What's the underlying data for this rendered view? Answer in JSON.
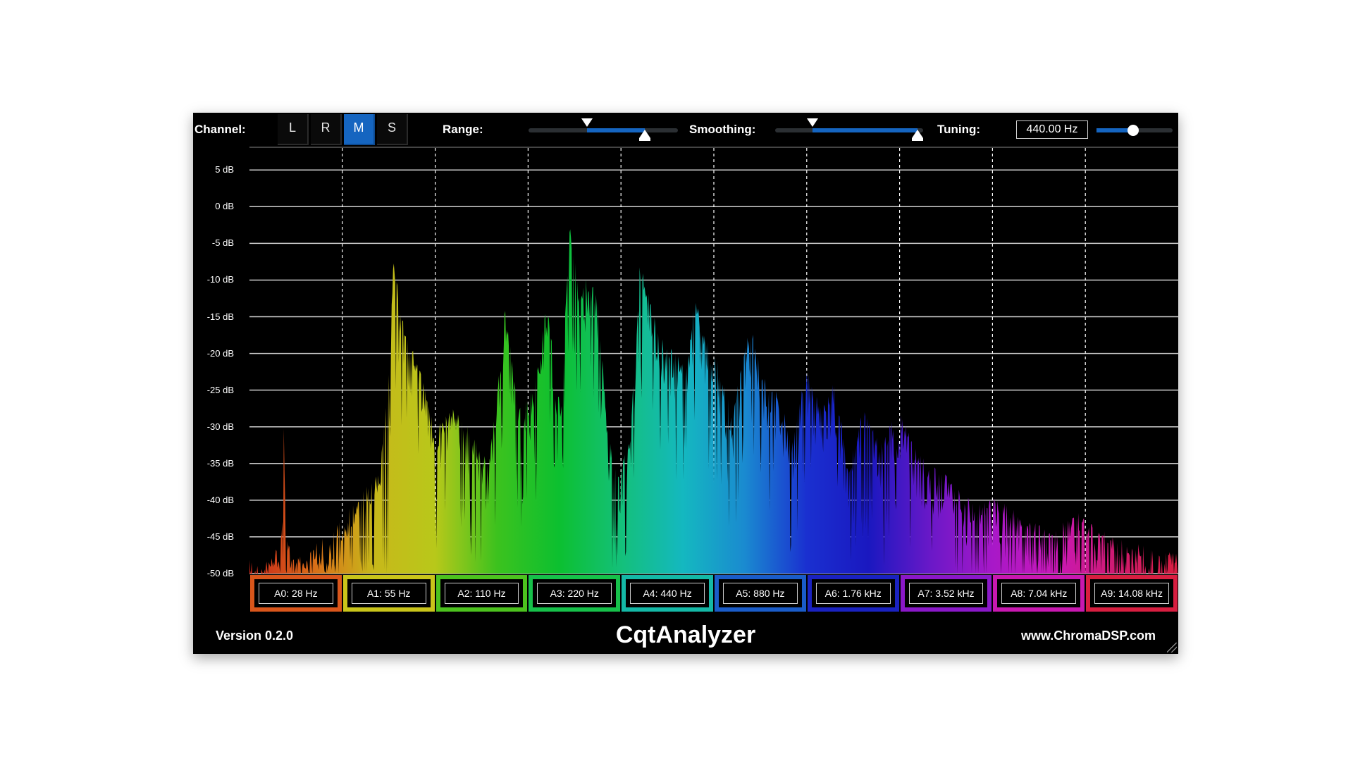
{
  "header": {
    "channel_label": "Channel:",
    "channel_buttons": [
      "L",
      "R",
      "M",
      "S"
    ],
    "channel_selected": "M",
    "range_label": "Range:",
    "range_low_pct": 0.39,
    "range_high_pct": 0.78,
    "smoothing_label": "Smoothing:",
    "smoothing_low_pct": 0.25,
    "smoothing_high_pct": 0.96,
    "tuning_label": "Tuning:",
    "tuning_value": "440.00 Hz",
    "tuning_level": 0.48
  },
  "footer": {
    "version": "Version 0.2.0",
    "title": "CqtAnalyzer",
    "url": "www.ChromaDSP.com"
  },
  "colors": {
    "accent": "#1565c0",
    "background": "#000000",
    "grid": "#cfcfcf"
  },
  "chart_data": {
    "type": "area",
    "title": "",
    "xlabel": "",
    "ylabel": "",
    "x_scale": "log",
    "ylim": [
      -50,
      8
    ],
    "y_ticks": [
      "5 dB",
      "0 dB",
      "-5 dB",
      "-10 dB",
      "-15 dB",
      "-20 dB",
      "-25 dB",
      "-30 dB",
      "-35 dB",
      "-40 dB",
      "-45 dB",
      "-50 dB"
    ],
    "y_tick_values": [
      5,
      0,
      -5,
      -10,
      -15,
      -20,
      -25,
      -30,
      -35,
      -40,
      -45,
      -50
    ],
    "grid": true,
    "octave_labels": [
      "A0: 28 Hz",
      "A1: 55 Hz",
      "A2: 110 Hz",
      "A3: 220 Hz",
      "A4: 440 Hz",
      "A5: 880 Hz",
      "A6: 1.76 kHz",
      "A7: 3.52 kHz",
      "A8: 7.04 kHz",
      "A9: 14.08 kHz"
    ],
    "octave_colors": [
      "#d9561b",
      "#c9c41a",
      "#4cc21e",
      "#16c04a",
      "#14b8a6",
      "#1a5cc8",
      "#1a22c0",
      "#8a18c8",
      "#c818b0",
      "#d81e40"
    ],
    "series": [
      {
        "x_octaves": [
          0,
          0.2,
          0.35,
          0.37,
          0.39,
          0.5,
          0.7,
          0.9,
          1.0,
          1.2,
          1.4,
          1.5,
          1.55,
          1.6,
          1.7,
          1.85,
          2.0,
          2.2,
          2.4,
          2.55,
          2.65,
          2.75,
          2.9,
          3.0,
          3.1,
          3.2,
          3.35,
          3.45,
          3.55,
          3.65,
          3.75,
          3.85,
          3.95,
          4.1,
          4.2,
          4.3,
          4.4,
          4.55,
          4.7,
          4.8,
          4.9,
          5.0,
          5.1,
          5.2,
          5.3,
          5.4,
          5.55,
          5.7,
          5.85,
          6.0,
          6.15,
          6.3,
          6.45,
          6.6,
          6.8,
          7.0,
          7.2,
          7.4,
          7.6,
          7.8,
          8.0,
          8.3,
          8.6,
          8.9,
          9.1,
          9.3,
          9.5,
          9.7,
          10.0
        ],
        "db_values": [
          -50,
          -48,
          -44,
          -26,
          -44,
          -48,
          -46,
          -44,
          -42,
          -39,
          -36,
          -22,
          -10,
          -12,
          -20,
          -25,
          -32,
          -30,
          -33,
          -37,
          -30,
          -16,
          -30,
          -28,
          -24,
          -15,
          -30,
          -4,
          -13,
          -12,
          -14,
          -32,
          -38,
          -34,
          -10,
          -14,
          -18,
          -22,
          -24,
          -14,
          -20,
          -22,
          -26,
          -30,
          -24,
          -18,
          -26,
          -28,
          -34,
          -24,
          -30,
          -26,
          -38,
          -30,
          -34,
          -30,
          -36,
          -38,
          -40,
          -43,
          -42,
          -44,
          -46,
          -44,
          -46,
          -47,
          -48,
          -49,
          -49
        ]
      }
    ]
  }
}
